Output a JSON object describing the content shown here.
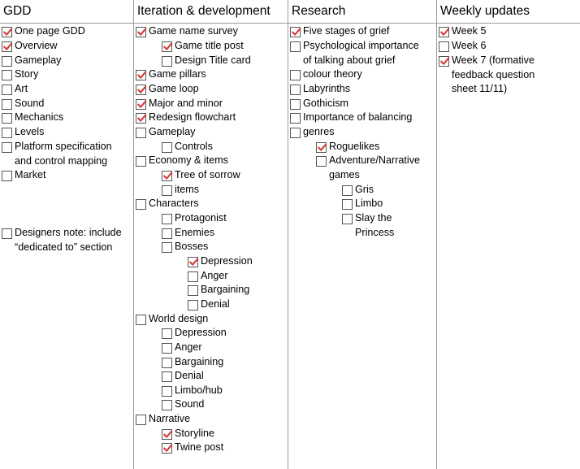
{
  "columns": [
    {
      "title": "GDD",
      "items": [
        {
          "text": "One page GDD",
          "checked": true,
          "level": 0
        },
        {
          "text": "Overview",
          "checked": true,
          "level": 0
        },
        {
          "text": "Gameplay",
          "checked": false,
          "level": 0
        },
        {
          "text": "Story",
          "checked": false,
          "level": 0
        },
        {
          "text": "Art",
          "checked": false,
          "level": 0
        },
        {
          "text": "Sound",
          "checked": false,
          "level": 0
        },
        {
          "text": "Mechanics",
          "checked": false,
          "level": 0
        },
        {
          "text": "Levels",
          "checked": false,
          "level": 0
        },
        {
          "text": "Platform specification and control mapping",
          "checked": false,
          "level": 0
        },
        {
          "text": "Market",
          "checked": false,
          "level": 0
        },
        {
          "text": "Designers note: include “dedicated to” section",
          "checked": false,
          "level": 0
        }
      ]
    },
    {
      "title": "Iteration & development",
      "items": [
        {
          "text": "Game name survey",
          "checked": true,
          "level": 0
        },
        {
          "text": "Game title post",
          "checked": true,
          "level": 1
        },
        {
          "text": "Design Title card",
          "checked": false,
          "level": 1
        },
        {
          "text": "Game pillars",
          "checked": true,
          "level": 0
        },
        {
          "text": "Game loop",
          "checked": true,
          "level": 0
        },
        {
          "text": "Major and minor",
          "checked": true,
          "level": 0
        },
        {
          "text": "Redesign flowchart",
          "checked": true,
          "level": 0
        },
        {
          "text": "Gameplay",
          "checked": false,
          "level": 0
        },
        {
          "text": "Controls",
          "checked": false,
          "level": 1
        },
        {
          "text": "Economy & items",
          "checked": false,
          "level": 0
        },
        {
          "text": "Tree of sorrow",
          "checked": true,
          "level": 1
        },
        {
          "text": "items",
          "checked": false,
          "level": 1
        },
        {
          "text": "Characters",
          "checked": false,
          "level": 0
        },
        {
          "text": "Protagonist",
          "checked": false,
          "level": 1
        },
        {
          "text": "Enemies",
          "checked": false,
          "level": 1
        },
        {
          "text": "Bosses",
          "checked": false,
          "level": 1
        },
        {
          "text": "Depression",
          "checked": true,
          "level": 2
        },
        {
          "text": "Anger",
          "checked": false,
          "level": 2
        },
        {
          "text": "Bargaining",
          "checked": false,
          "level": 2
        },
        {
          "text": "Denial",
          "checked": false,
          "level": 2
        },
        {
          "text": "World design",
          "checked": false,
          "level": 0
        },
        {
          "text": "Depression",
          "checked": false,
          "level": 1
        },
        {
          "text": "Anger",
          "checked": false,
          "level": 1
        },
        {
          "text": "Bargaining",
          "checked": false,
          "level": 1
        },
        {
          "text": "Denial",
          "checked": false,
          "level": 1
        },
        {
          "text": "Limbo/hub",
          "checked": false,
          "level": 1
        },
        {
          "text": "Sound",
          "checked": false,
          "level": 1
        },
        {
          "text": "Narrative",
          "checked": false,
          "level": 0
        },
        {
          "text": "Storyline",
          "checked": true,
          "level": 1
        },
        {
          "text": "Twine post",
          "checked": true,
          "level": 1
        }
      ]
    },
    {
      "title": "Research",
      "items": [
        {
          "text": "Five stages of grief",
          "checked": true,
          "level": 0
        },
        {
          "text": "Psychological importance of talking about grief",
          "checked": false,
          "level": 0
        },
        {
          "text": "colour theory",
          "checked": false,
          "level": 0
        },
        {
          "text": "Labyrinths",
          "checked": false,
          "level": 0
        },
        {
          "text": "Gothicism",
          "checked": false,
          "level": 0
        },
        {
          "text": "Importance of balancing",
          "checked": false,
          "level": 0
        },
        {
          "text": "genres",
          "checked": false,
          "level": 0
        },
        {
          "text": "Roguelikes",
          "checked": true,
          "level": 1
        },
        {
          "text": "Adventure/Narrative games",
          "checked": false,
          "level": 1
        },
        {
          "text": "Gris",
          "checked": false,
          "level": 2
        },
        {
          "text": "Limbo",
          "checked": false,
          "level": 2
        },
        {
          "text": "Slay the Princess",
          "checked": false,
          "level": 2
        }
      ]
    },
    {
      "title": "Weekly updates",
      "items": [
        {
          "text": "Week 5",
          "checked": true,
          "level": 0
        },
        {
          "text": "Week 6",
          "checked": false,
          "level": 0
        },
        {
          "text": "Week 7 (formative feedback question sheet 11/11)",
          "checked": true,
          "level": 0
        }
      ]
    }
  ],
  "colors": {
    "check": "#d63b35",
    "border": "#9a9a9a",
    "checkbox_border": "#555555"
  },
  "icons": {
    "checked": "checkbox-checked-icon",
    "unchecked": "checkbox-empty-icon"
  }
}
